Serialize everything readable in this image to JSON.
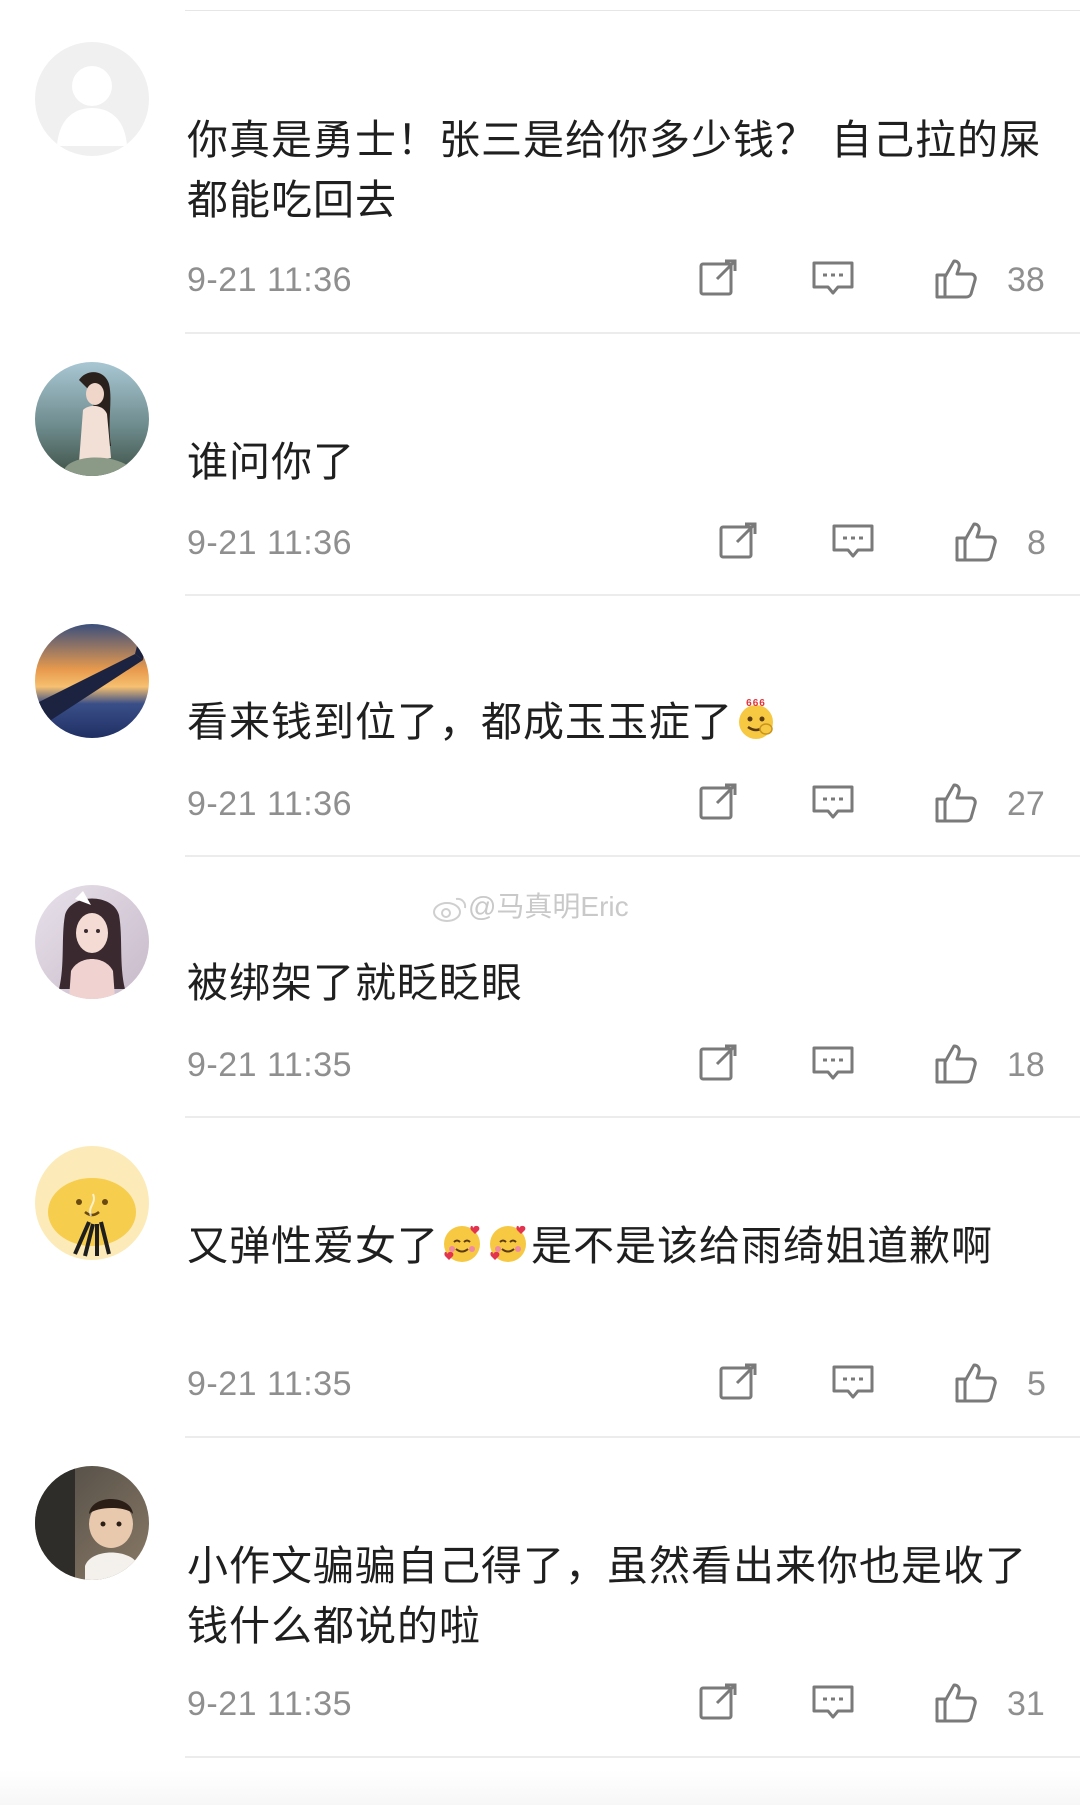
{
  "watermark": "@马真明Eric",
  "comments": [
    {
      "text": "你真是勇士！张三是给你多少钱？ 自己拉的屎都能吃回去",
      "time": "9-21 11:36",
      "likes": "38",
      "avatar": "default-gray"
    },
    {
      "text": "谁问你了",
      "time": "9-21 11:36",
      "likes": "8",
      "avatar": "girl-beach"
    },
    {
      "text": "看来钱到位了，都成玉玉症了",
      "time": "9-21 11:36",
      "likes": "27",
      "avatar": "airplane-wing-sunset"
    },
    {
      "text": "被绑架了就眨眨眼",
      "time": "9-21 11:35",
      "likes": "18",
      "avatar": "anime-girl"
    },
    {
      "text_before": "又弹性爱女了",
      "text_after": "是不是该给雨绮姐道歉啊",
      "time": "9-21 11:35",
      "likes": "5",
      "avatar": "yellow-chick-incense"
    },
    {
      "text": "小作文骗骗自己得了，虽然看出来你也是收了钱什么都说的啦",
      "time": "9-21 11:35",
      "likes": "31",
      "avatar": "child-photo"
    }
  ],
  "icons": {
    "share": "share-icon",
    "reply": "comment-icon",
    "like": "thumbs-up-icon",
    "emoji_666": "emoji-666-icon",
    "emoji_hug": "hugging-face-emoji-icon"
  },
  "colors": {
    "meta_gray": "#8f8f8f",
    "icon_gray": "#7a7a7a",
    "divider": "#ececec"
  }
}
